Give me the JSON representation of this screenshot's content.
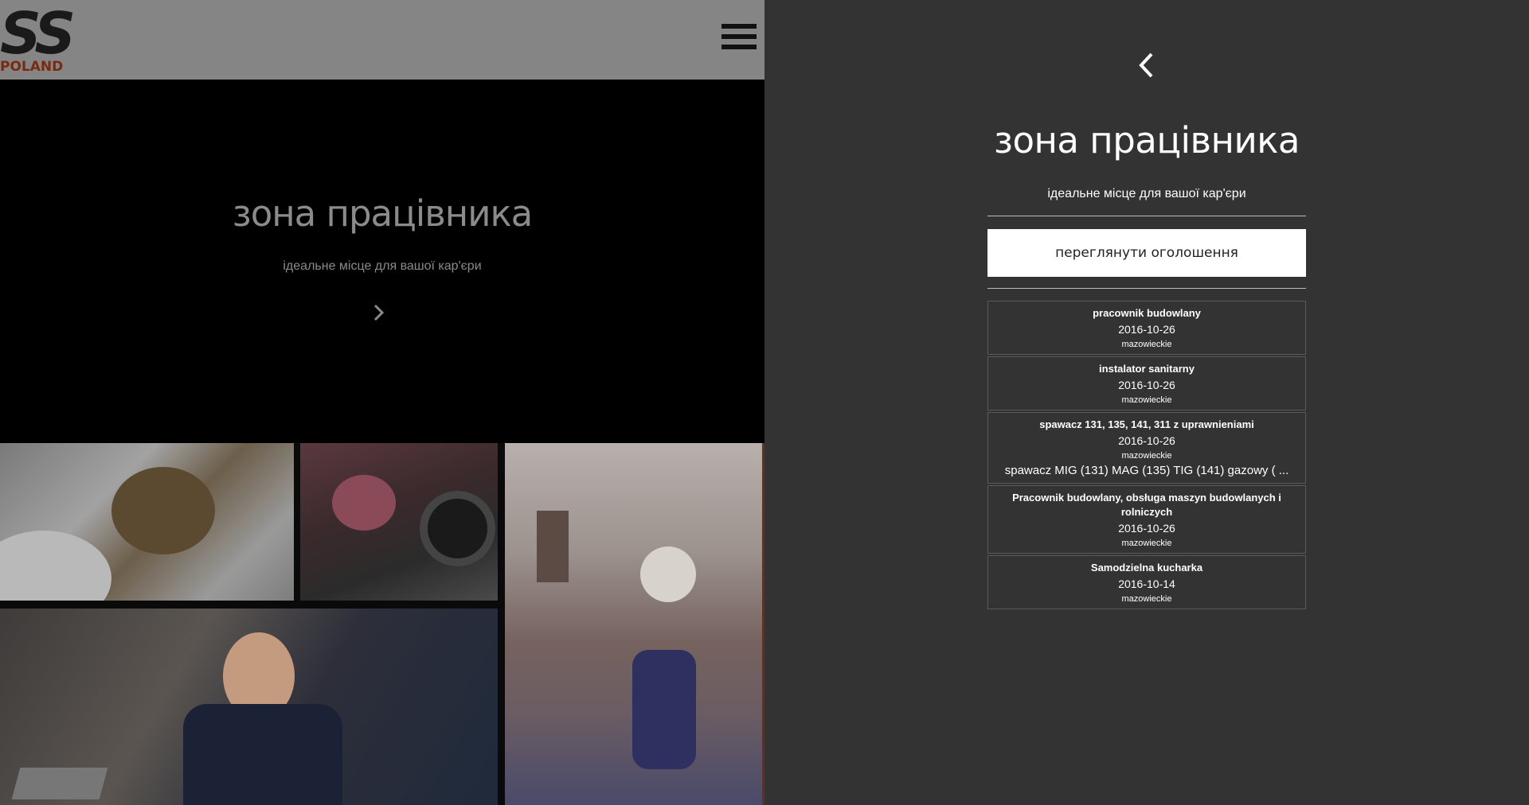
{
  "logo": {
    "mark": "SS",
    "sub": "POLAND"
  },
  "hero": {
    "title": "зона працівника",
    "subtitle": "ідеальне місце для вашої кар'єри"
  },
  "panel": {
    "title": "зона працівника",
    "subtitle": "ідеальне місце для вашої кар'єри",
    "button_label": "переглянути оголошення",
    "jobs": [
      {
        "title": "pracownik budowlany",
        "date": "2016-10-26",
        "region": "mazowieckie"
      },
      {
        "title": "instalator sanitarny",
        "date": "2016-10-26",
        "region": "mazowieckie"
      },
      {
        "title": "spawacz 131, 135, 141, 311 z uprawnieniami",
        "date": "2016-10-26",
        "region": "mazowieckie",
        "description": "spawacz MIG (131) MAG (135) TIG (141) gazowy ( ..."
      },
      {
        "title": "Pracownik budowlany, obsługa maszyn budowlanych i rolniczych",
        "date": "2016-10-26",
        "region": "mazowieckie"
      },
      {
        "title": "Samodzielna kucharka",
        "date": "2016-10-14",
        "region": "mazowieckie"
      }
    ]
  },
  "icons": {
    "menu": "hamburger-icon",
    "hero_next": "chevron-right-icon",
    "back": "chevron-left-icon"
  },
  "colors": {
    "panel_bg": "#333333",
    "topbar_bg": "#858585",
    "hero_bg": "#000000",
    "logo_accent": "#7a2a10"
  }
}
